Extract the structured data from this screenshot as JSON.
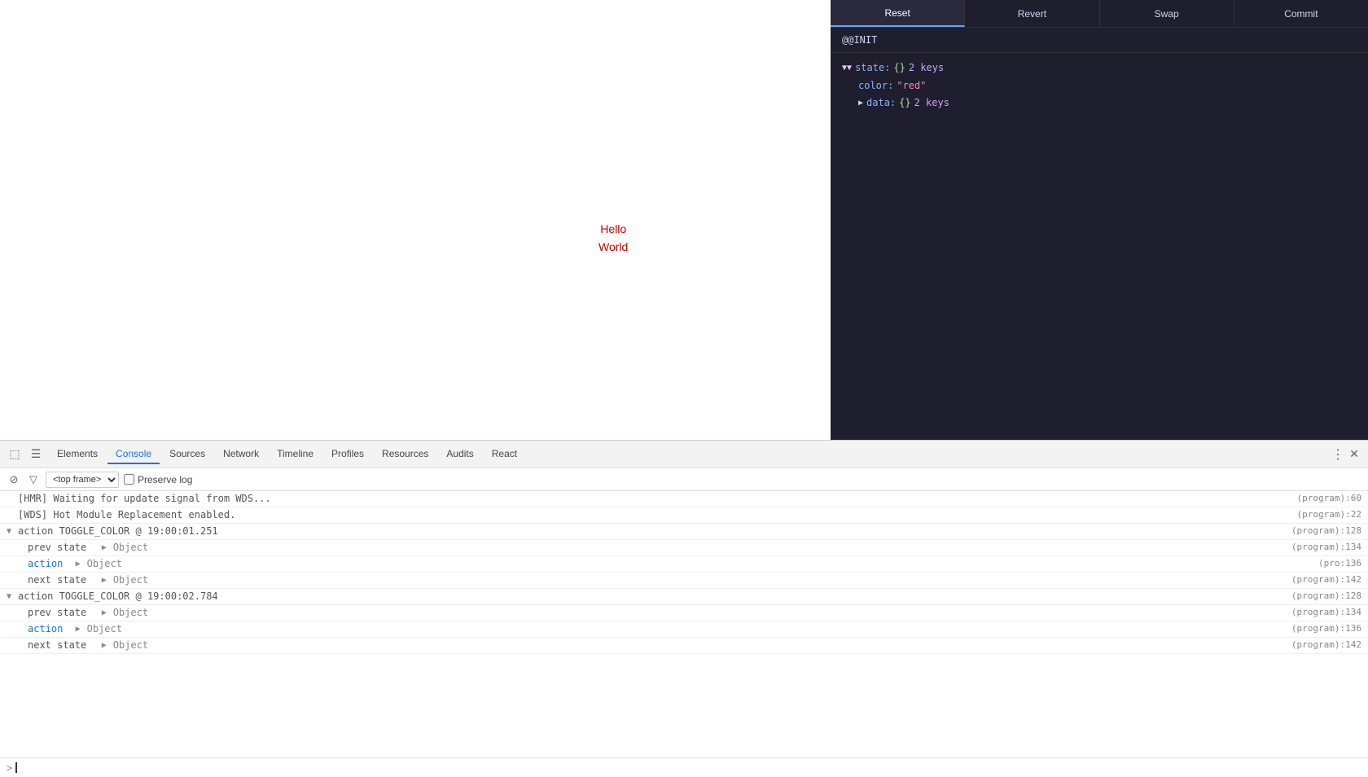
{
  "toolbar": {
    "buttons": [
      {
        "label": "Reset",
        "active": true
      },
      {
        "label": "Revert",
        "active": false
      },
      {
        "label": "Swap",
        "active": false
      },
      {
        "label": "Commit",
        "active": false
      }
    ]
  },
  "init_label": "@@INIT",
  "state_tree": {
    "state_key": "state:",
    "state_type": "{}",
    "state_count": "2 keys",
    "color_key": "color:",
    "color_val": "\"red\"",
    "data_key": "data:",
    "data_type": "{}",
    "data_count": "2 keys"
  },
  "preview": {
    "text_line1": "Hello",
    "text_line2": "World"
  },
  "devtools": {
    "tabs": [
      {
        "label": "Elements",
        "active": false
      },
      {
        "label": "Console",
        "active": true
      },
      {
        "label": "Sources",
        "active": false
      },
      {
        "label": "Network",
        "active": false
      },
      {
        "label": "Timeline",
        "active": false
      },
      {
        "label": "Profiles",
        "active": false
      },
      {
        "label": "Resources",
        "active": false
      },
      {
        "label": "Audits",
        "active": false
      },
      {
        "label": "React",
        "active": false
      }
    ],
    "frame_select": "<top frame>",
    "preserve_log": "Preserve log",
    "console_lines": [
      {
        "id": "hmr-line",
        "indent": 0,
        "text": "[HMR] Waiting for update signal from WDS...",
        "source": "(program):60",
        "toggle": null
      },
      {
        "id": "wds-line",
        "indent": 0,
        "text": "[WDS] Hot Module Replacement enabled.",
        "source": "(program):22",
        "toggle": null
      },
      {
        "id": "action1-header",
        "indent": 0,
        "text": "action TOGGLE_COLOR @ 19:00:01.251",
        "source": "(program):128",
        "toggle": "down"
      },
      {
        "id": "action1-prev",
        "indent": 1,
        "text_prefix": "prev state",
        "text_arrow": "▶ Object",
        "source": "(program):134",
        "toggle": null
      },
      {
        "id": "action1-action",
        "indent": 1,
        "text_prefix": "action",
        "text_arrow": "▶ Object",
        "source": "(pro:136",
        "toggle": null,
        "is_action": true
      },
      {
        "id": "action1-next",
        "indent": 1,
        "text_prefix": "next state",
        "text_arrow": "▶ Object",
        "source": "(program):142",
        "toggle": null
      },
      {
        "id": "action2-header",
        "indent": 0,
        "text": "action TOGGLE_COLOR @ 19:00:02.784",
        "source": "(program):128",
        "toggle": "down"
      },
      {
        "id": "action2-prev",
        "indent": 1,
        "text_prefix": "prev state",
        "text_arrow": "▶ Object",
        "source": "(program):134",
        "toggle": null
      },
      {
        "id": "action2-action",
        "indent": 1,
        "text_prefix": "action",
        "text_arrow": "▶ Object",
        "source": "(program):136",
        "toggle": null,
        "is_action": true
      },
      {
        "id": "action2-next",
        "indent": 1,
        "text_prefix": "next state",
        "text_arrow": "▶ Object",
        "source": "(program):142",
        "toggle": null
      }
    ]
  }
}
